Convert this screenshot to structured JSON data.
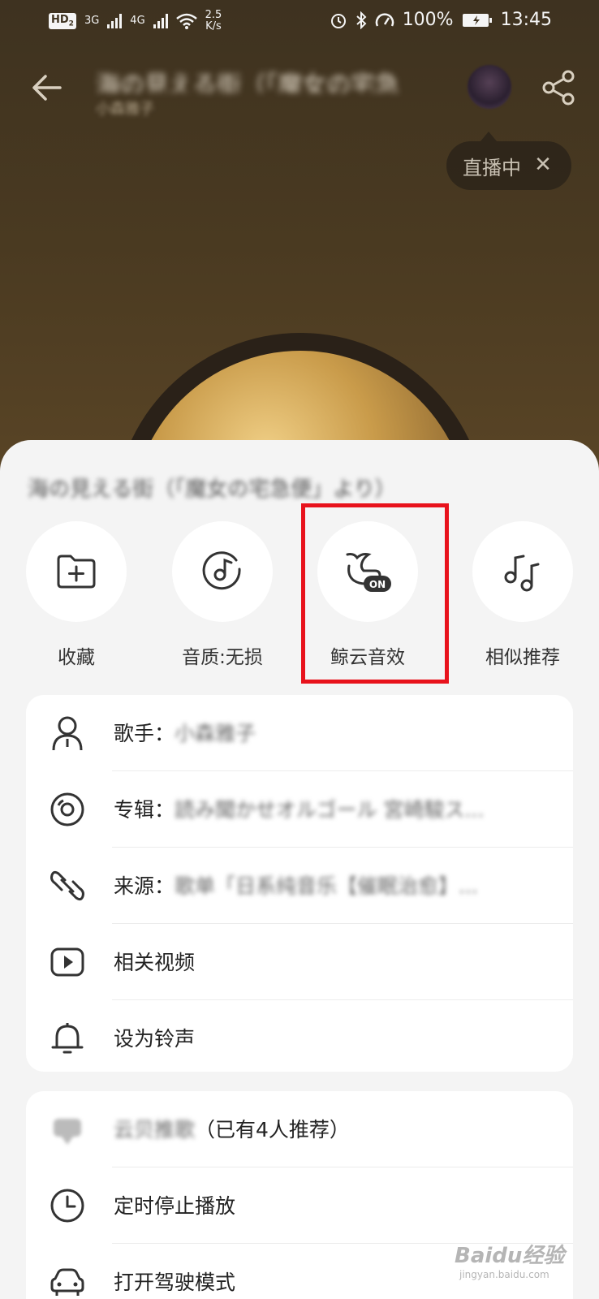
{
  "status_bar": {
    "hd": "HD",
    "hd_sub": "2",
    "net1": "3G",
    "net2": "4G",
    "speed": "2.5",
    "speed_unit": "K/s",
    "battery": "100%",
    "time": "13:45"
  },
  "header": {
    "song_title": "海の見える街（「魔女の宅急",
    "artist": "小森雅子"
  },
  "live_pill": {
    "label": "直播中",
    "close": "✕"
  },
  "sheet": {
    "song_title": "海の見える街（「魔女の宅急便」より）",
    "actions": [
      {
        "label": "收藏",
        "icon": "folder-plus-icon"
      },
      {
        "label": "音质:无损",
        "icon": "music-disc-icon"
      },
      {
        "label": "鲸云音效",
        "icon": "whale-effect-icon",
        "badge": "ON"
      },
      {
        "label": "相似推荐",
        "icon": "music-notes-icon"
      }
    ],
    "info_rows": [
      {
        "prefix": "歌手：",
        "value": "小森雅子",
        "icon": "person-icon"
      },
      {
        "prefix": "专辑：",
        "value": "読み聞かせオルゴール 宮崎駿ス...",
        "icon": "album-icon"
      },
      {
        "prefix": "来源：",
        "value": "歌单「日系纯音乐【催眠治愈】...",
        "icon": "link-icon"
      },
      {
        "prefix": "相关视频",
        "value": "",
        "icon": "video-icon"
      },
      {
        "prefix": "设为铃声",
        "value": "",
        "icon": "bell-icon"
      }
    ],
    "other_rows": [
      {
        "prefix": "云贝推歌",
        "value": "（已有4人推荐）",
        "icon": "promote-icon"
      },
      {
        "prefix": "定时停止播放",
        "value": "",
        "icon": "clock-icon"
      },
      {
        "prefix": "打开驾驶模式",
        "value": "",
        "icon": "car-icon"
      }
    ]
  },
  "watermark": {
    "brand": "Baidu经验",
    "url": "jingyan.baidu.com"
  },
  "colors": {
    "highlight": "#e8121c",
    "sheet_bg": "#f4f4f4",
    "player_bg": "#4a3a22"
  }
}
